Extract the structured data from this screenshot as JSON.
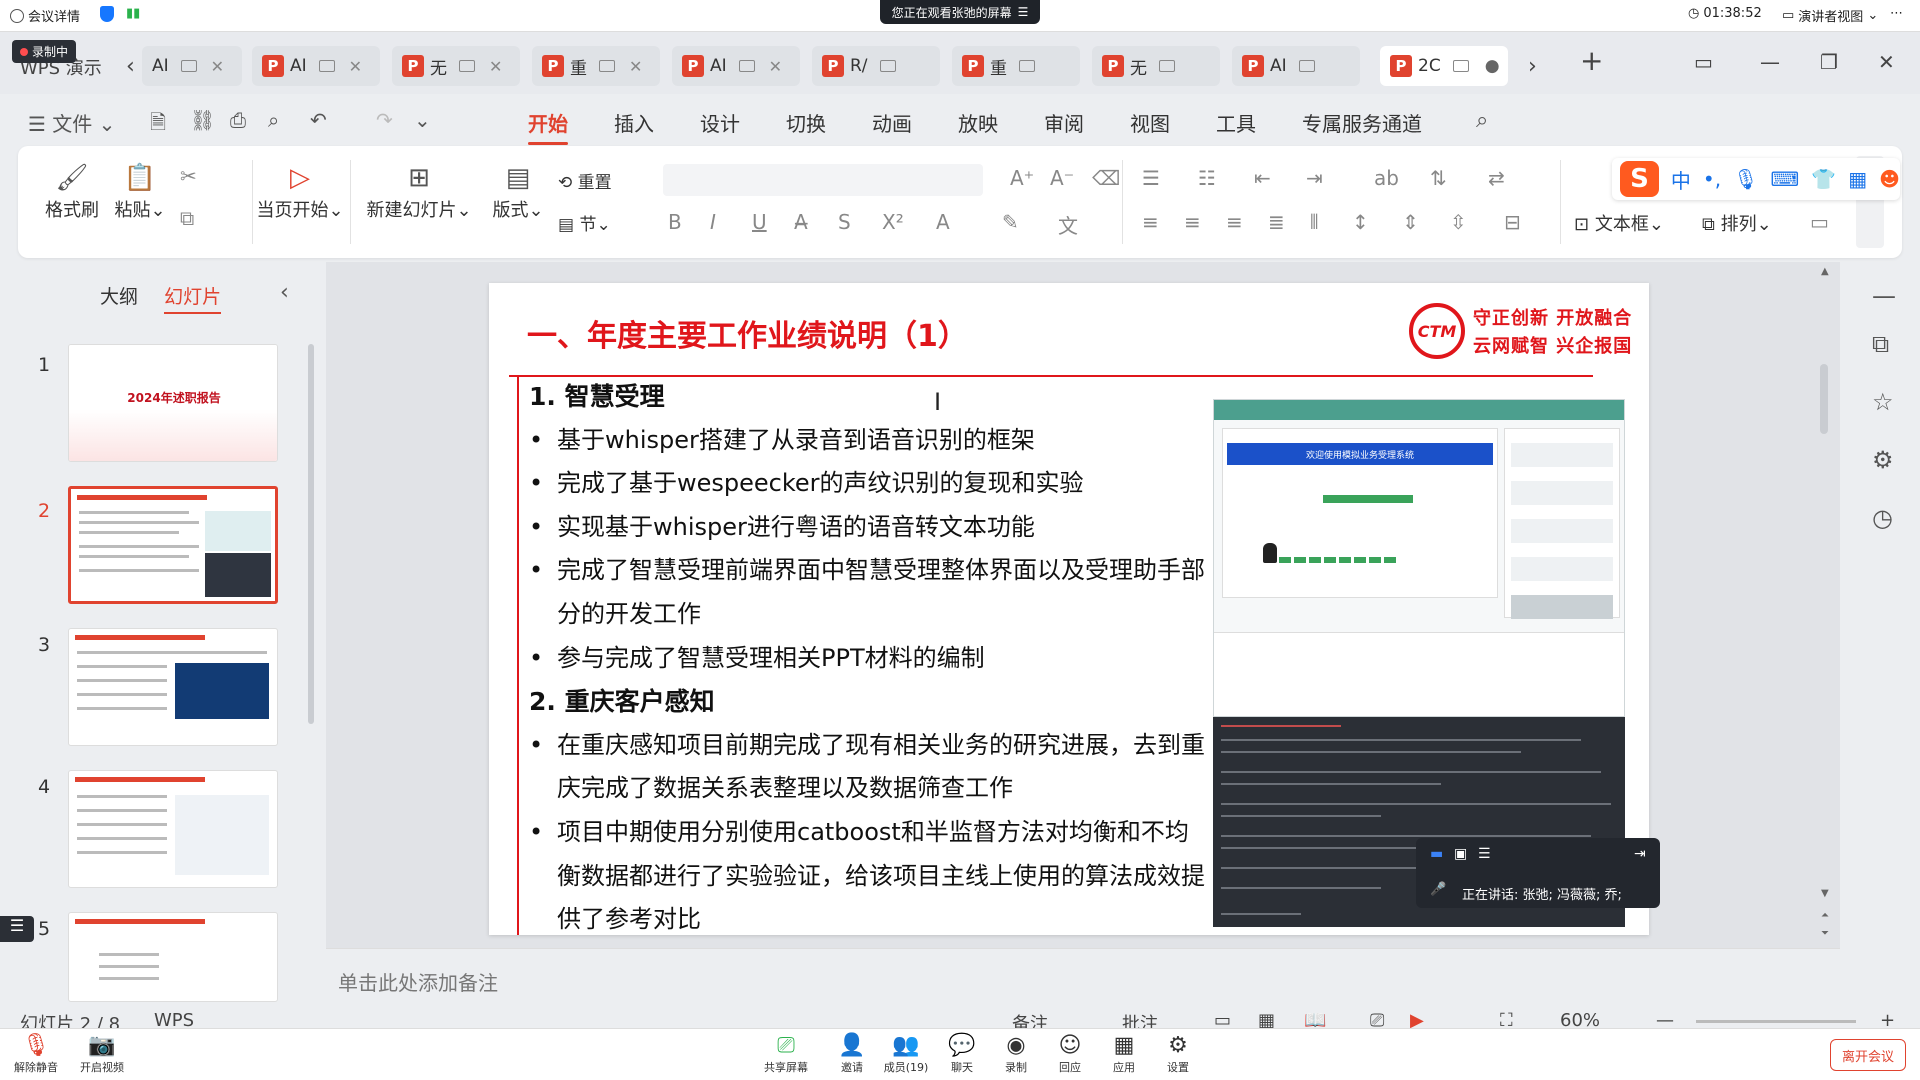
{
  "meeting": {
    "details_label": "会议详情",
    "sharing_banner": "您正在观看张弛的屏幕",
    "timer": "01:38:52",
    "presenter_view": "演讲者视图",
    "recording": "录制中",
    "speaking": "正在讲话: 张弛; 冯薇薇; 乔;",
    "bottom_buttons": [
      "解除静音",
      "开启视频",
      "共享屏幕",
      "邀请",
      "成员(19)",
      "聊天",
      "录制",
      "回应",
      "应用",
      "设置"
    ],
    "leave": "离开会议"
  },
  "app": {
    "title": "WPS 演示",
    "tabs": [
      {
        "label": "AI"
      },
      {
        "label": "AI"
      },
      {
        "label": "无"
      },
      {
        "label": "重"
      },
      {
        "label": "AI"
      },
      {
        "label": "R/"
      },
      {
        "label": "重"
      },
      {
        "label": "无"
      },
      {
        "label": "AI"
      },
      {
        "label": "2C"
      }
    ],
    "file_menu": "文件",
    "menu": [
      "开始",
      "插入",
      "设计",
      "切换",
      "动画",
      "放映",
      "审阅",
      "视图",
      "工具",
      "专属服务通道"
    ],
    "active_menu": "开始"
  },
  "ribbon": {
    "format_painter": "格式刷",
    "paste": "粘贴",
    "from_current": "当页开始",
    "new_slide": "新建幻灯片",
    "layout": "版式",
    "reset": "重置",
    "section": "节",
    "textbox": "文本框",
    "arrange": "排列"
  },
  "left_panel": {
    "outline_tab": "大纲",
    "slides_tab": "幻灯片",
    "thumbs": [
      {
        "num": "1",
        "title": "2024年述职报告"
      },
      {
        "num": "2"
      },
      {
        "num": "3"
      },
      {
        "num": "4"
      },
      {
        "num": "5"
      }
    ],
    "selected": 2
  },
  "slide": {
    "title": "一、年度主要工作业绩说明（1）",
    "slogan_line1": "守正创新 开放融合",
    "slogan_line2": "云网赋智 兴企报国",
    "logo_text": "CTM",
    "lines": [
      {
        "kind": "h",
        "text": "1.   智慧受理"
      },
      {
        "kind": "b",
        "text": "基于whisper搭建了从录音到语音识别的框架"
      },
      {
        "kind": "b",
        "text": "完成了基于wespeecker的声纹识别的复现和实验"
      },
      {
        "kind": "b",
        "text": "实现基于whisper进行粤语的语音转文本功能"
      },
      {
        "kind": "b",
        "text": "完成了智慧受理前端界面中智慧受理整体界面以及受理助手部分的开发工作"
      },
      {
        "kind": "b",
        "text": "参与完成了智慧受理相关PPT材料的编制"
      },
      {
        "kind": "h",
        "text": "2.   重庆客户感知"
      },
      {
        "kind": "b",
        "text": "在重庆感知项目前期完成了现有相关业务的研究进展，去到重庆完成了数据关系表整理以及数据筛查工作"
      },
      {
        "kind": "b",
        "text": "项目中期使用分别使用catboost和半监督方法对均衡和不均衡数据都进行了实验验证，给该项目主线上使用的算法成效提供了参考对比"
      }
    ],
    "shot_title": "欢迎使用模拟业务受理系统"
  },
  "notes_placeholder": "单击此处添加备注",
  "status": {
    "slide_counter": "幻灯片 2 / 8",
    "theme": "WPS",
    "notes": "备注",
    "comments": "批注",
    "zoom": "60%"
  }
}
